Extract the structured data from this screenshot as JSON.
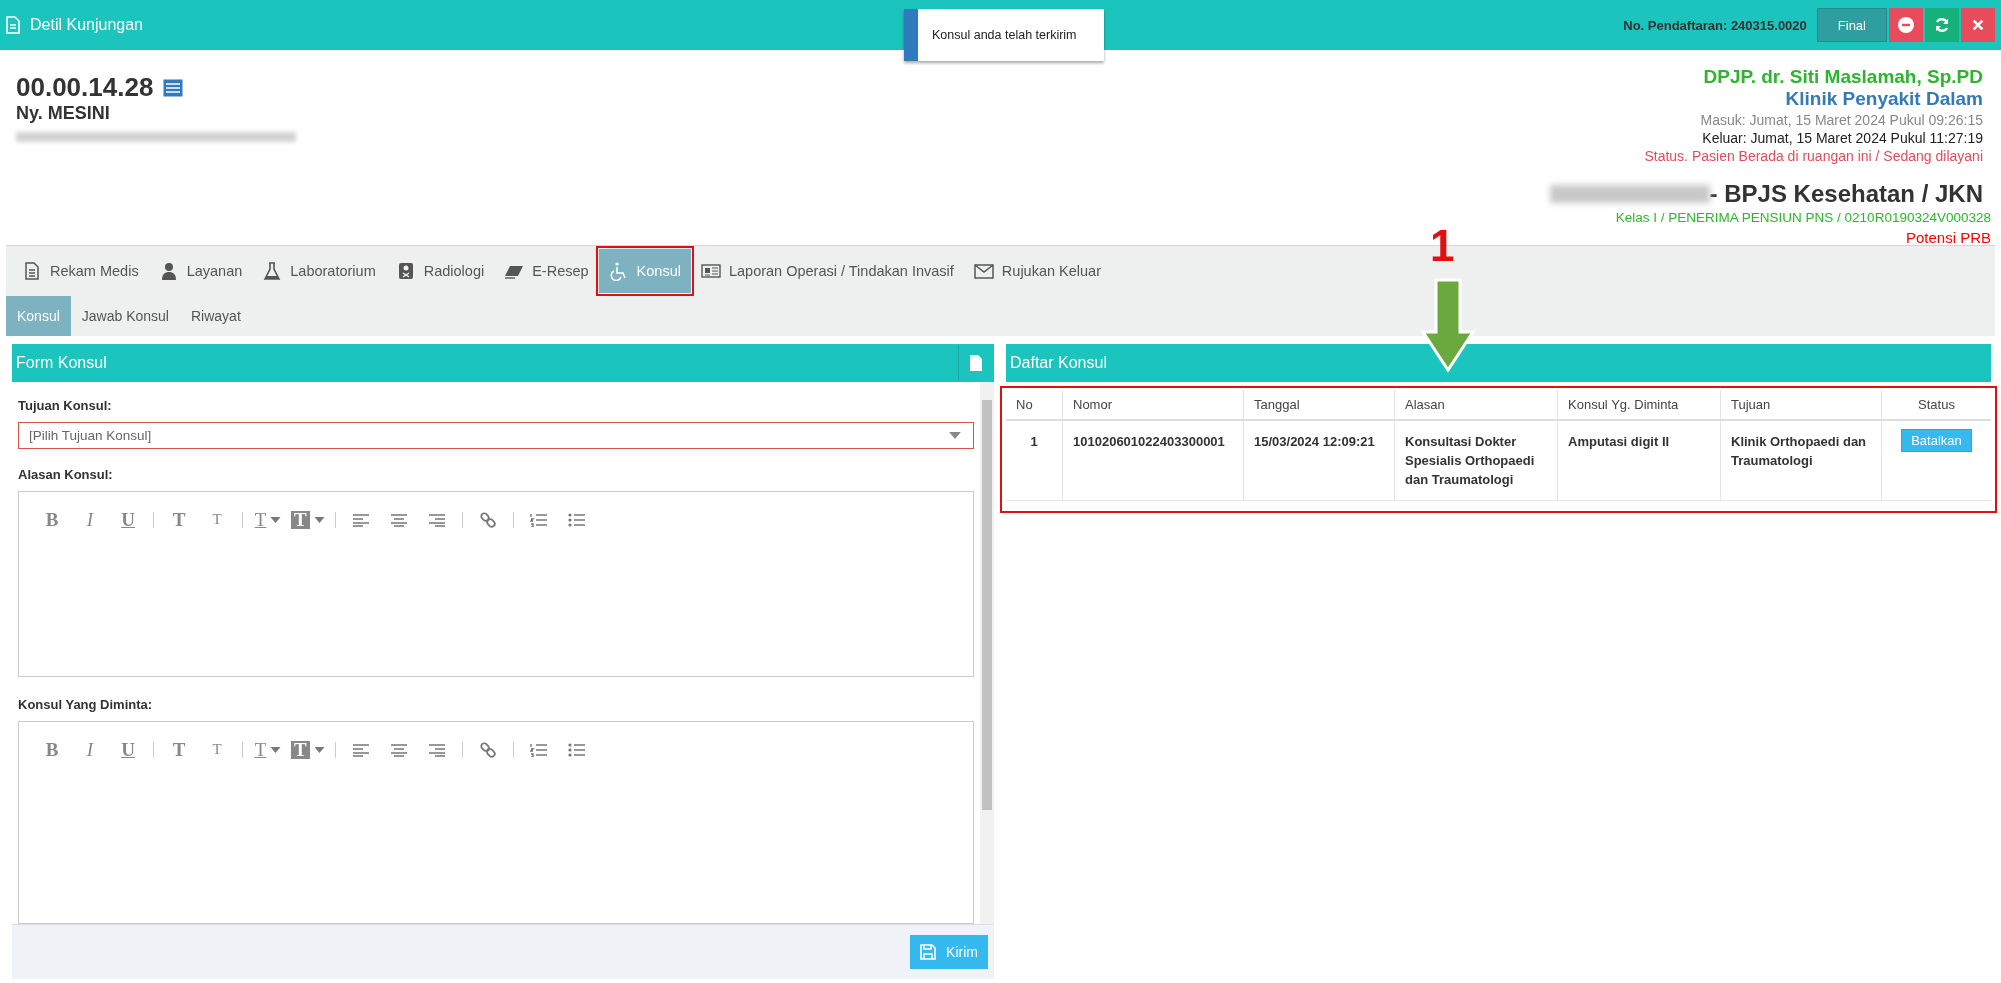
{
  "topbar": {
    "title": "Detil Kunjungan",
    "registration": "No. Pendaftaran: 240315.0020",
    "final_button": "Final"
  },
  "toast": {
    "message": "Konsul anda telah terkirim"
  },
  "patient": {
    "record_number": "00.00.14.28",
    "name": "Ny. MESINI"
  },
  "visit": {
    "doctor": "DPJP. dr. Siti Maslamah, Sp.PD",
    "clinic": "Klinik Penyakit Dalam",
    "entry": "Masuk: Jumat, 15 Maret 2024 Pukul 09:26:15",
    "exit": "Keluar: Jumat, 15 Maret 2024 Pukul 11:27:19",
    "status": "Status. Pasien Berada di ruangan ini / Sedang dilayani",
    "insurance": "- BPJS Kesehatan / JKN",
    "class_info": "Kelas I / PENERIMA PENSIUN PNS / 0210R0190324V000328",
    "prb": "Potensi PRB"
  },
  "tabs": [
    {
      "label": "Rekam Medis",
      "kind": "document",
      "selected": false,
      "outlined": false
    },
    {
      "label": "Layanan",
      "kind": "doctor",
      "selected": false,
      "outlined": false
    },
    {
      "label": "Laboratorium",
      "kind": "flask",
      "selected": false,
      "outlined": false
    },
    {
      "label": "Radiologi",
      "kind": "xray",
      "selected": false,
      "outlined": false
    },
    {
      "label": "E-Resep",
      "kind": "eraser",
      "selected": false,
      "outlined": false
    },
    {
      "label": "Konsul",
      "kind": "wheelchair",
      "selected": true,
      "outlined": true
    },
    {
      "label": "Laporan Operasi / Tindakan Invasif",
      "kind": "newspaper",
      "selected": false,
      "outlined": false
    },
    {
      "label": "Rujukan Keluar",
      "kind": "envelope",
      "selected": false,
      "outlined": false
    }
  ],
  "subtabs": [
    {
      "label": "Konsul",
      "selected": true
    },
    {
      "label": "Jawab Konsul",
      "selected": false
    },
    {
      "label": "Riwayat",
      "selected": false
    }
  ],
  "annotation": {
    "label": "1"
  },
  "form": {
    "title": "Form Konsul",
    "target_label": "Tujuan Konsul:",
    "target_placeholder": "[Pilih Tujuan Konsul]",
    "submit": "Kirim",
    "editors": [
      {
        "label": "Alasan Konsul:",
        "toolbar": [
          {
            "kind": "bold",
            "glyph": "B"
          },
          {
            "kind": "italic",
            "glyph": "I"
          },
          {
            "kind": "underline",
            "glyph": "U"
          },
          {
            "kind": "sep"
          },
          {
            "kind": "sup",
            "glyph": "T"
          },
          {
            "kind": "sub",
            "glyph": "T"
          },
          {
            "kind": "sep"
          },
          {
            "kind": "color",
            "glyph": "T"
          },
          {
            "kind": "background",
            "glyph": "T"
          },
          {
            "kind": "sep"
          },
          {
            "kind": "align-left"
          },
          {
            "kind": "align-center"
          },
          {
            "kind": "align-right"
          },
          {
            "kind": "sep"
          },
          {
            "kind": "link"
          },
          {
            "kind": "sep"
          },
          {
            "kind": "ordered-list"
          },
          {
            "kind": "bullet-list"
          }
        ]
      },
      {
        "label": "Konsul Yang Diminta:",
        "toolbar": [
          {
            "kind": "bold",
            "glyph": "B"
          },
          {
            "kind": "italic",
            "glyph": "I"
          },
          {
            "kind": "underline",
            "glyph": "U"
          },
          {
            "kind": "sep"
          },
          {
            "kind": "sup",
            "glyph": "T"
          },
          {
            "kind": "sub",
            "glyph": "T"
          },
          {
            "kind": "sep"
          },
          {
            "kind": "color",
            "glyph": "T"
          },
          {
            "kind": "background",
            "glyph": "T"
          },
          {
            "kind": "sep"
          },
          {
            "kind": "align-left"
          },
          {
            "kind": "align-center"
          },
          {
            "kind": "align-right"
          },
          {
            "kind": "sep"
          },
          {
            "kind": "link"
          },
          {
            "kind": "sep"
          },
          {
            "kind": "ordered-list"
          },
          {
            "kind": "bullet-list"
          }
        ]
      }
    ]
  },
  "list": {
    "title": "Daftar Konsul",
    "outlined": true,
    "columns": [
      "No",
      "Nomor",
      "Tanggal",
      "Alasan",
      "Konsul Yg. Diminta",
      "Tujuan",
      "Status"
    ],
    "rows": [
      {
        "no": "1",
        "nomor": "101020601022403300001",
        "tanggal": "15/03/2024 12:09:21",
        "alasan": "Konsultasi Dokter Spesialis Orthopaedi dan Traumatologi",
        "diminta": "Amputasi digit II",
        "tujuan": "Klinik Orthopaedi dan Traumatologi",
        "action": "Batalkan"
      }
    ]
  }
}
